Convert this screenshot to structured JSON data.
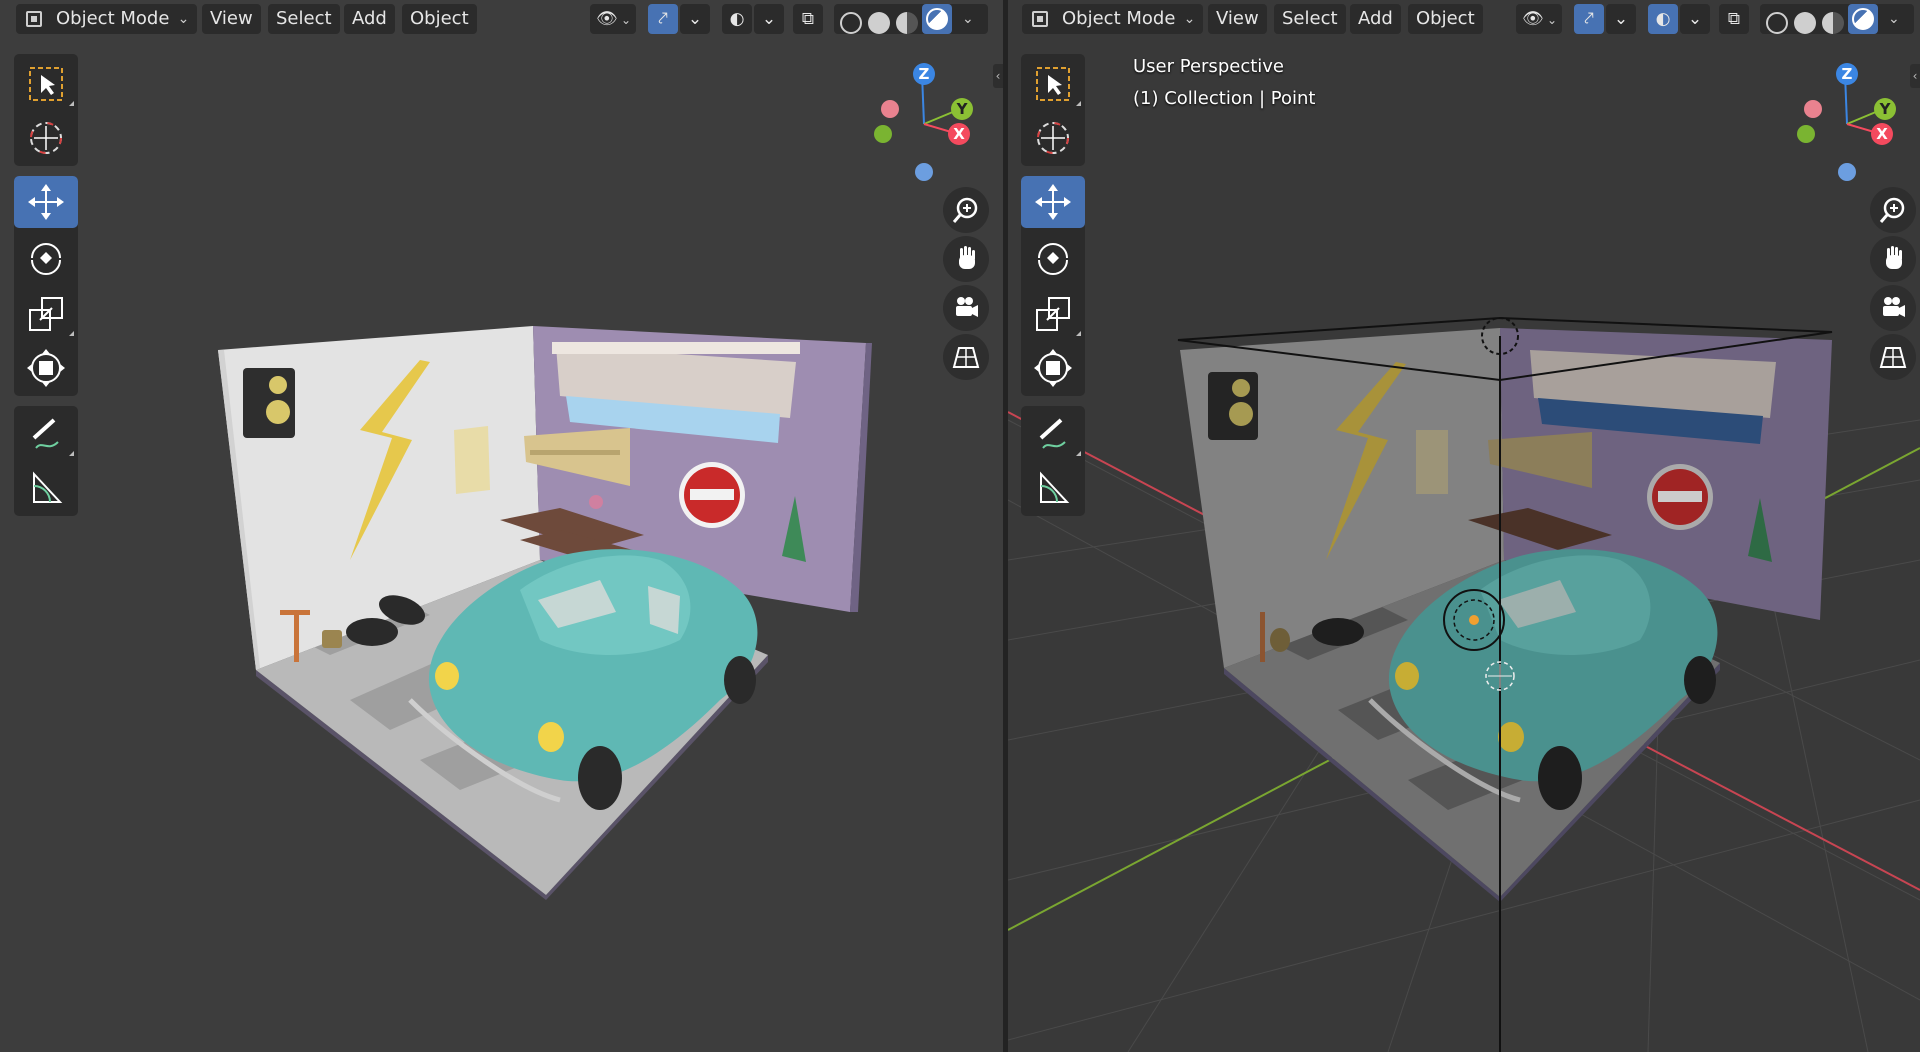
{
  "header": {
    "mode_label": "Object Mode",
    "menus": [
      "View",
      "Select",
      "Add",
      "Object"
    ]
  },
  "viewport_right": {
    "perspective_label": "User Perspective",
    "collection_label": "(1) Collection | Point"
  },
  "gizmo": {
    "z_label": "Z",
    "y_label": "Y",
    "x_label": "X"
  },
  "icons": {
    "tools": [
      "select-box-icon",
      "cursor-icon",
      "move-icon",
      "rotate-icon",
      "scale-icon",
      "transform-icon",
      "annotate-icon",
      "measure-icon"
    ],
    "nav": [
      "zoom-icon",
      "pan-hand-icon",
      "camera-icon",
      "grid-icon"
    ]
  },
  "colors": {
    "accent": "#4772b3",
    "axis_x": "#f44a5e",
    "axis_y": "#8bc034",
    "axis_z": "#3b86e3",
    "grid_x": "#c84552",
    "grid_y": "#7aa631"
  }
}
